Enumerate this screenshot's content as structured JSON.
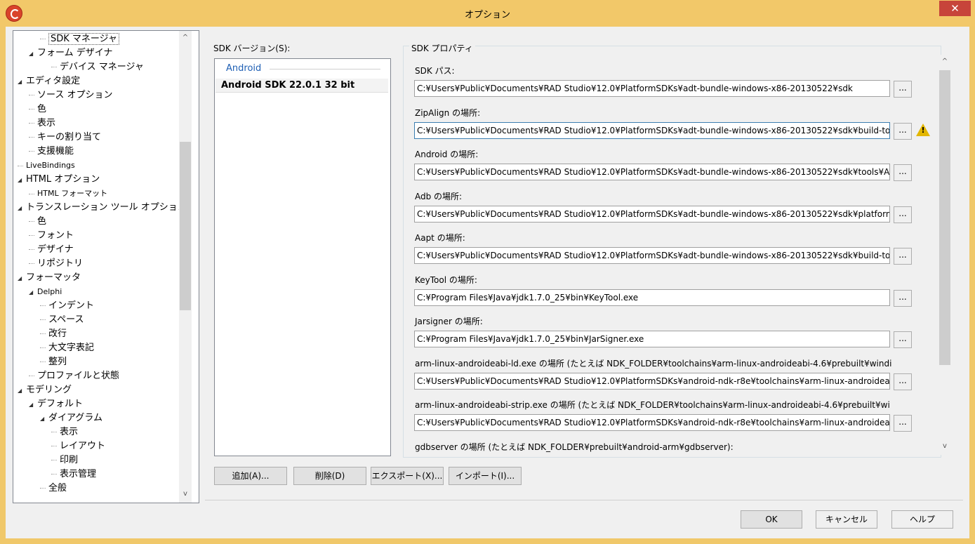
{
  "window": {
    "title": "オプション",
    "close_label": "✕"
  },
  "tree": {
    "items": [
      {
        "label": "SDK マネージャ",
        "indent": 3,
        "expander": "",
        "selected": true
      },
      {
        "label": "フォーム デザイナ",
        "indent": 2,
        "expander": "◢"
      },
      {
        "label": "デバイス マネージャ",
        "indent": 4,
        "expander": ""
      },
      {
        "label": "エディタ設定",
        "indent": 1,
        "expander": "◢"
      },
      {
        "label": "ソース オプション",
        "indent": 2,
        "expander": ""
      },
      {
        "label": "色",
        "indent": 2,
        "expander": ""
      },
      {
        "label": "表示",
        "indent": 2,
        "expander": ""
      },
      {
        "label": "キーの割り当て",
        "indent": 2,
        "expander": ""
      },
      {
        "label": "支援機能",
        "indent": 2,
        "expander": ""
      },
      {
        "label": "LiveBindings",
        "indent": 1,
        "expander": "",
        "small": true
      },
      {
        "label": "HTML オプション",
        "indent": 1,
        "expander": "◢"
      },
      {
        "label": "HTML フォーマット",
        "indent": 2,
        "expander": "",
        "small": true
      },
      {
        "label": "トランスレーション ツール オプション",
        "indent": 1,
        "expander": "◢"
      },
      {
        "label": "色",
        "indent": 2,
        "expander": ""
      },
      {
        "label": "フォント",
        "indent": 2,
        "expander": ""
      },
      {
        "label": "デザイナ",
        "indent": 2,
        "expander": ""
      },
      {
        "label": "リポジトリ",
        "indent": 2,
        "expander": ""
      },
      {
        "label": "フォーマッタ",
        "indent": 1,
        "expander": "◢"
      },
      {
        "label": "Delphi",
        "indent": 2,
        "expander": "◢",
        "small": true
      },
      {
        "label": "インデント",
        "indent": 3,
        "expander": ""
      },
      {
        "label": "スペース",
        "indent": 3,
        "expander": ""
      },
      {
        "label": "改行",
        "indent": 3,
        "expander": ""
      },
      {
        "label": "大文字表記",
        "indent": 3,
        "expander": ""
      },
      {
        "label": "整列",
        "indent": 3,
        "expander": ""
      },
      {
        "label": "プロファイルと状態",
        "indent": 2,
        "expander": ""
      },
      {
        "label": "モデリング",
        "indent": 1,
        "expander": "◢"
      },
      {
        "label": "デフォルト",
        "indent": 2,
        "expander": "◢"
      },
      {
        "label": "ダイアグラム",
        "indent": 3,
        "expander": "◢"
      },
      {
        "label": "表示",
        "indent": 4,
        "expander": ""
      },
      {
        "label": "レイアウト",
        "indent": 4,
        "expander": ""
      },
      {
        "label": "印刷",
        "indent": 4,
        "expander": ""
      },
      {
        "label": "表示管理",
        "indent": 4,
        "expander": ""
      },
      {
        "label": "全般",
        "indent": 3,
        "expander": ""
      }
    ]
  },
  "sdk": {
    "version_label": "SDK バージョン(S):",
    "group": "Android",
    "selected_item": "Android SDK 22.0.1 32 bit",
    "buttons": {
      "add": "追加(A)...",
      "delete": "削除(D)",
      "export": "エクスポート(X)...",
      "import": "インポート(I)..."
    }
  },
  "properties": {
    "legend": "SDK プロパティ",
    "fields": [
      {
        "label": "SDK パス:",
        "value": "C:¥Users¥Public¥Documents¥RAD Studio¥12.0¥PlatformSDKs¥adt-bundle-windows-x86-20130522¥sdk"
      },
      {
        "label": "ZipAlign の場所:",
        "value": "C:¥Users¥Public¥Documents¥RAD Studio¥12.0¥PlatformSDKs¥adt-bundle-windows-x86-20130522¥sdk¥build-to",
        "warning": true
      },
      {
        "label": "Android の場所:",
        "value": "C:¥Users¥Public¥Documents¥RAD Studio¥12.0¥PlatformSDKs¥adt-bundle-windows-x86-20130522¥sdk¥tools¥A"
      },
      {
        "label": "Adb の場所:",
        "value": "C:¥Users¥Public¥Documents¥RAD Studio¥12.0¥PlatformSDKs¥adt-bundle-windows-x86-20130522¥sdk¥platforn"
      },
      {
        "label": "Aapt の場所:",
        "value": "C:¥Users¥Public¥Documents¥RAD Studio¥12.0¥PlatformSDKs¥adt-bundle-windows-x86-20130522¥sdk¥build-to"
      },
      {
        "label": "KeyTool の場所:",
        "value": "C:¥Program Files¥Java¥jdk1.7.0_25¥bin¥KeyTool.exe"
      },
      {
        "label": "Jarsigner の場所:",
        "value": "C:¥Program Files¥Java¥jdk1.7.0_25¥bin¥JarSigner.exe"
      },
      {
        "label": "arm-linux-androideabi-ld.exe の場所 (たとえば NDK_FOLDER¥toolchains¥arm-linux-androideabi-4.6¥prebuilt¥windi",
        "value": "C:¥Users¥Public¥Documents¥RAD Studio¥12.0¥PlatformSDKs¥android-ndk-r8e¥toolchains¥arm-linux-androideat"
      },
      {
        "label": "arm-linux-androideabi-strip.exe の場所 (たとえば NDK_FOLDER¥toolchains¥arm-linux-androideabi-4.6¥prebuilt¥wi",
        "value": "C:¥Users¥Public¥Documents¥RAD Studio¥12.0¥PlatformSDKs¥android-ndk-r8e¥toolchains¥arm-linux-androideat"
      },
      {
        "label": "gdbserver の場所 (たとえば NDK_FOLDER¥prebuilt¥android-arm¥gdbserver):",
        "value": ""
      }
    ],
    "browse_label": "...",
    "warning_mark": "!"
  },
  "footer": {
    "ok": "OK",
    "cancel": "キャンセル",
    "help": "ヘルプ"
  },
  "scroll": {
    "up": "^",
    "down": "v"
  }
}
